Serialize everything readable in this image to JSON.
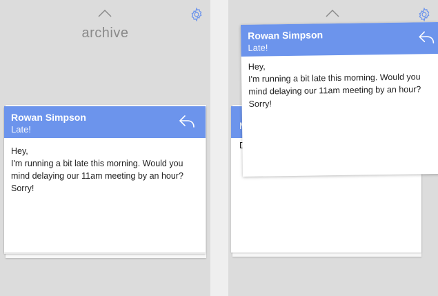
{
  "left_panel": {
    "title": "archive",
    "icons": {
      "top_chevron": "chevron-up-icon",
      "settings": "gear-icon"
    }
  },
  "email": {
    "sender": "Rowan Simpson",
    "subject": "Late!",
    "body_lines": [
      "Hey,",
      "I'm running a bit late this morning. Would you",
      "mind delaying our 11am meeting by an hour?",
      "Sorry!"
    ],
    "reply_icon": "reply-icon"
  },
  "right_panel": {
    "peek_letters": {
      "header": "M",
      "body": "D"
    }
  },
  "colors": {
    "accent": "#6c94ec",
    "panel_bg": "#dcdcdc",
    "card_bg": "#ffffff",
    "text": "#222222",
    "muted": "#8a8a8a"
  }
}
